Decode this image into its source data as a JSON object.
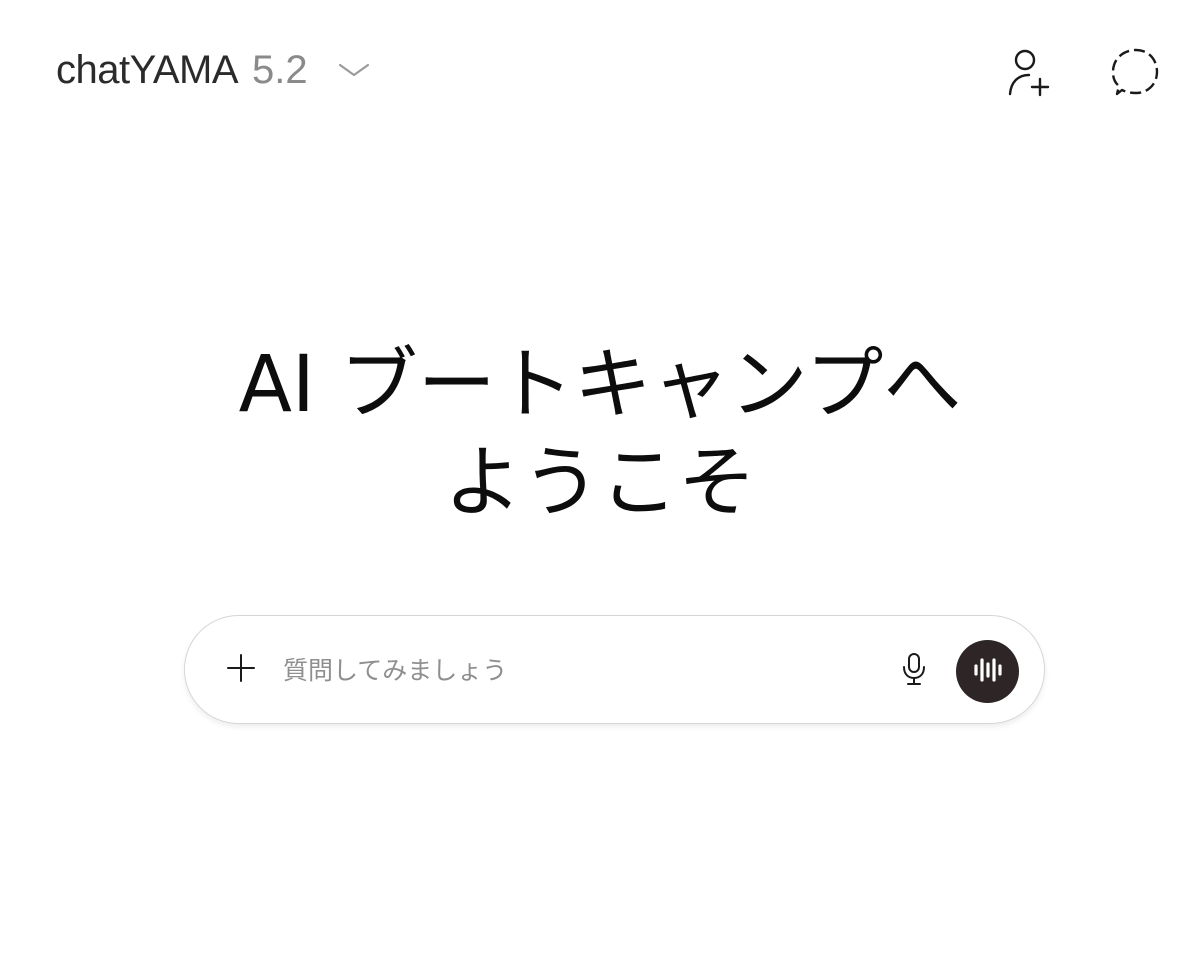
{
  "header": {
    "app_name": "chatYAMA",
    "version": "5.2",
    "chevron_icon": "chevron-down-icon",
    "add_user_icon": "add-user-icon",
    "temp_chat_icon": "dashed-chat-bubble-icon"
  },
  "hero": {
    "line1": "AI ブートキャンプへ",
    "line2": "ようこそ"
  },
  "composer": {
    "placeholder": "質問してみましょう",
    "value": "",
    "attach_icon": "plus-icon",
    "mic_icon": "microphone-icon",
    "voice_icon": "voice-waveform-icon"
  },
  "colors": {
    "text": "#0d0d0d",
    "muted": "#8a8a8a",
    "placeholder": "#8f8f8f",
    "composer_border": "#d6d6d6",
    "voice_button": "#2e2626"
  }
}
